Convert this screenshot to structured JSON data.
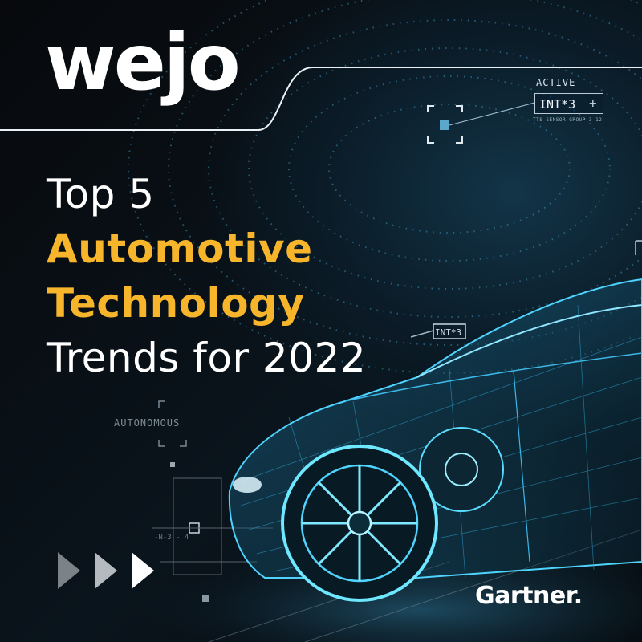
{
  "brand": {
    "logo_text": "wejo",
    "partner_logo_text": "Gartner"
  },
  "headline": {
    "line1": "Top 5",
    "line2": "Automotive",
    "line3": "Technology",
    "line4": "Trends for 2022"
  },
  "hud": {
    "status_label": "ACTIVE",
    "code_primary": "INT*3",
    "sensor_caption": "TTS  SENSOR GROUP 3-12",
    "code_secondary": "INT*3",
    "mode_label": "AUTONOMOUS",
    "small_code": "-N-3 - 4"
  },
  "colors": {
    "accent_yellow": "#f7b52b",
    "text_white": "#ffffff",
    "wireframe_cyan": "#3fd0ff",
    "background": "#05080d"
  },
  "icons": {
    "next_arrows": "triple-chevron-right-icon"
  }
}
